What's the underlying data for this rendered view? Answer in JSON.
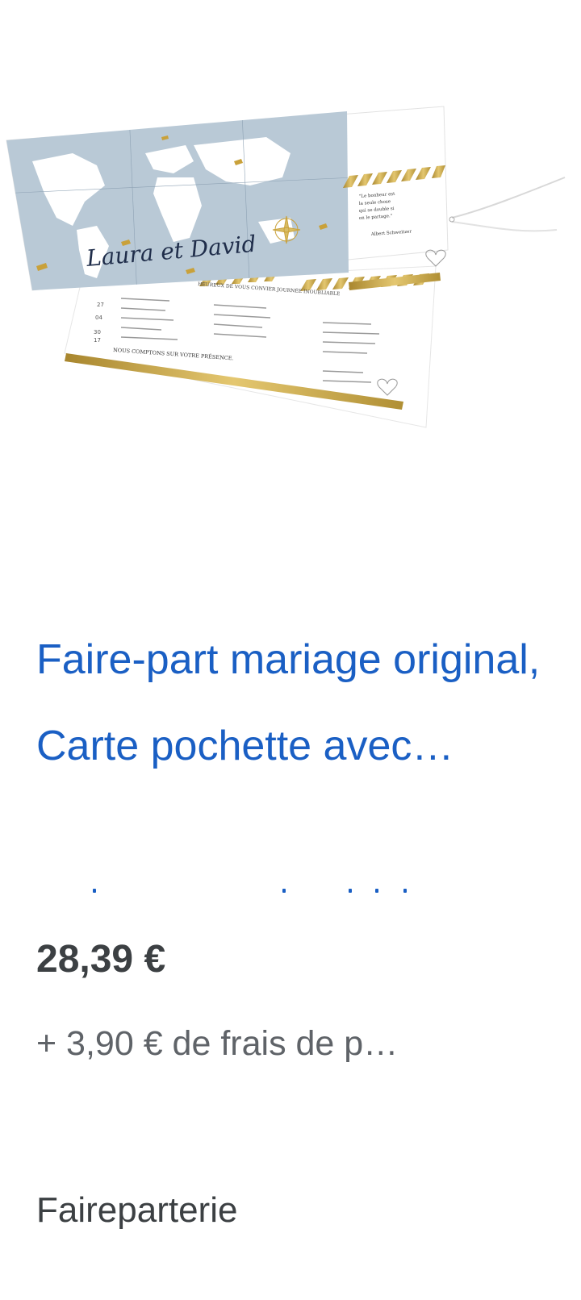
{
  "product": {
    "image_alt": "Faire-part mariage carte pochette carte du monde",
    "card_names": "Laura et David",
    "card_quote": "Le bonheur est la seule chose qui se double si on le partage.",
    "card_quote_author": "Albert Schweitzer",
    "card_invite_line": "HEUREUX DE VOUS CONVIER JOURNÉE INOUBLIABLE",
    "card_footer_line": "NOUS COMPTONS SUR VOTRE PRÉSENCE.",
    "title": "Faire-part mariage original, Carte pochette avec…",
    "price": "28,39 €",
    "shipping": "+ 3,90 € de frais de p…",
    "seller": "Faireparterie"
  },
  "colors": {
    "title_link": "#1a5fc4",
    "price_text": "#3c4043",
    "secondary_text": "#5f6368",
    "gold": "#c9a13a",
    "map_blue": "#b9c9d6"
  }
}
